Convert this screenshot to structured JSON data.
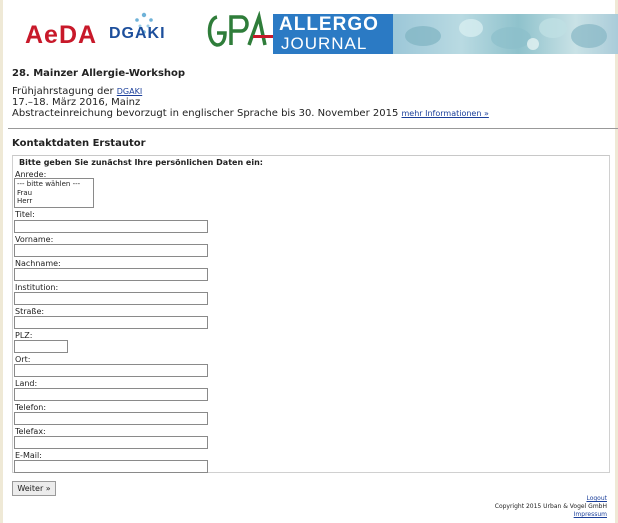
{
  "header": {
    "logo_aeda": "AeDA",
    "logo_dgaki": "DGAKI",
    "logo_gpa": "GPA",
    "allergo_line1": "ALLERGO",
    "allergo_line2": "JOURNAL"
  },
  "workshop": {
    "title": "28. Mainzer Allergie-Workshop",
    "line1_prefix": "Frühjahrstagung der ",
    "line1_link": "DGAKI",
    "line2": "17.–18. März 2016, Mainz",
    "line3": "Abstracteinreichung bevorzugt in englischer Sprache bis 30. November 2015 ",
    "more_link": "mehr Informationen »"
  },
  "form": {
    "section_title": "Kontaktdaten Erstautor",
    "legend": "Bitte geben Sie zunächst Ihre persönlichen Daten ein:",
    "anrede_label": "Anrede:",
    "anrede_options": [
      "--- bitte wählen ---",
      "Frau",
      "Herr"
    ],
    "fields": {
      "titel": "Titel:",
      "vorname": "Vorname:",
      "nachname": "Nachname:",
      "institution": "Institution:",
      "strasse": "Straße:",
      "plz": "PLZ:",
      "ort": "Ort:",
      "land": "Land:",
      "telefon": "Telefon:",
      "telefax": "Telefax:",
      "email": "E-Mail:"
    },
    "submit_label": "Weiter »"
  },
  "footer": {
    "logout": "Logout",
    "copyright": "Copyright 2015 Urban & Vogel GmbH",
    "impressum": "Impressum"
  },
  "colors": {
    "aeda_red": "#c8192a",
    "dgaki_blue": "#1d4f9c",
    "gpa_green": "#2f7d3a",
    "allergo_blue": "#2b7ac4",
    "link_blue": "#1b3f9a"
  }
}
